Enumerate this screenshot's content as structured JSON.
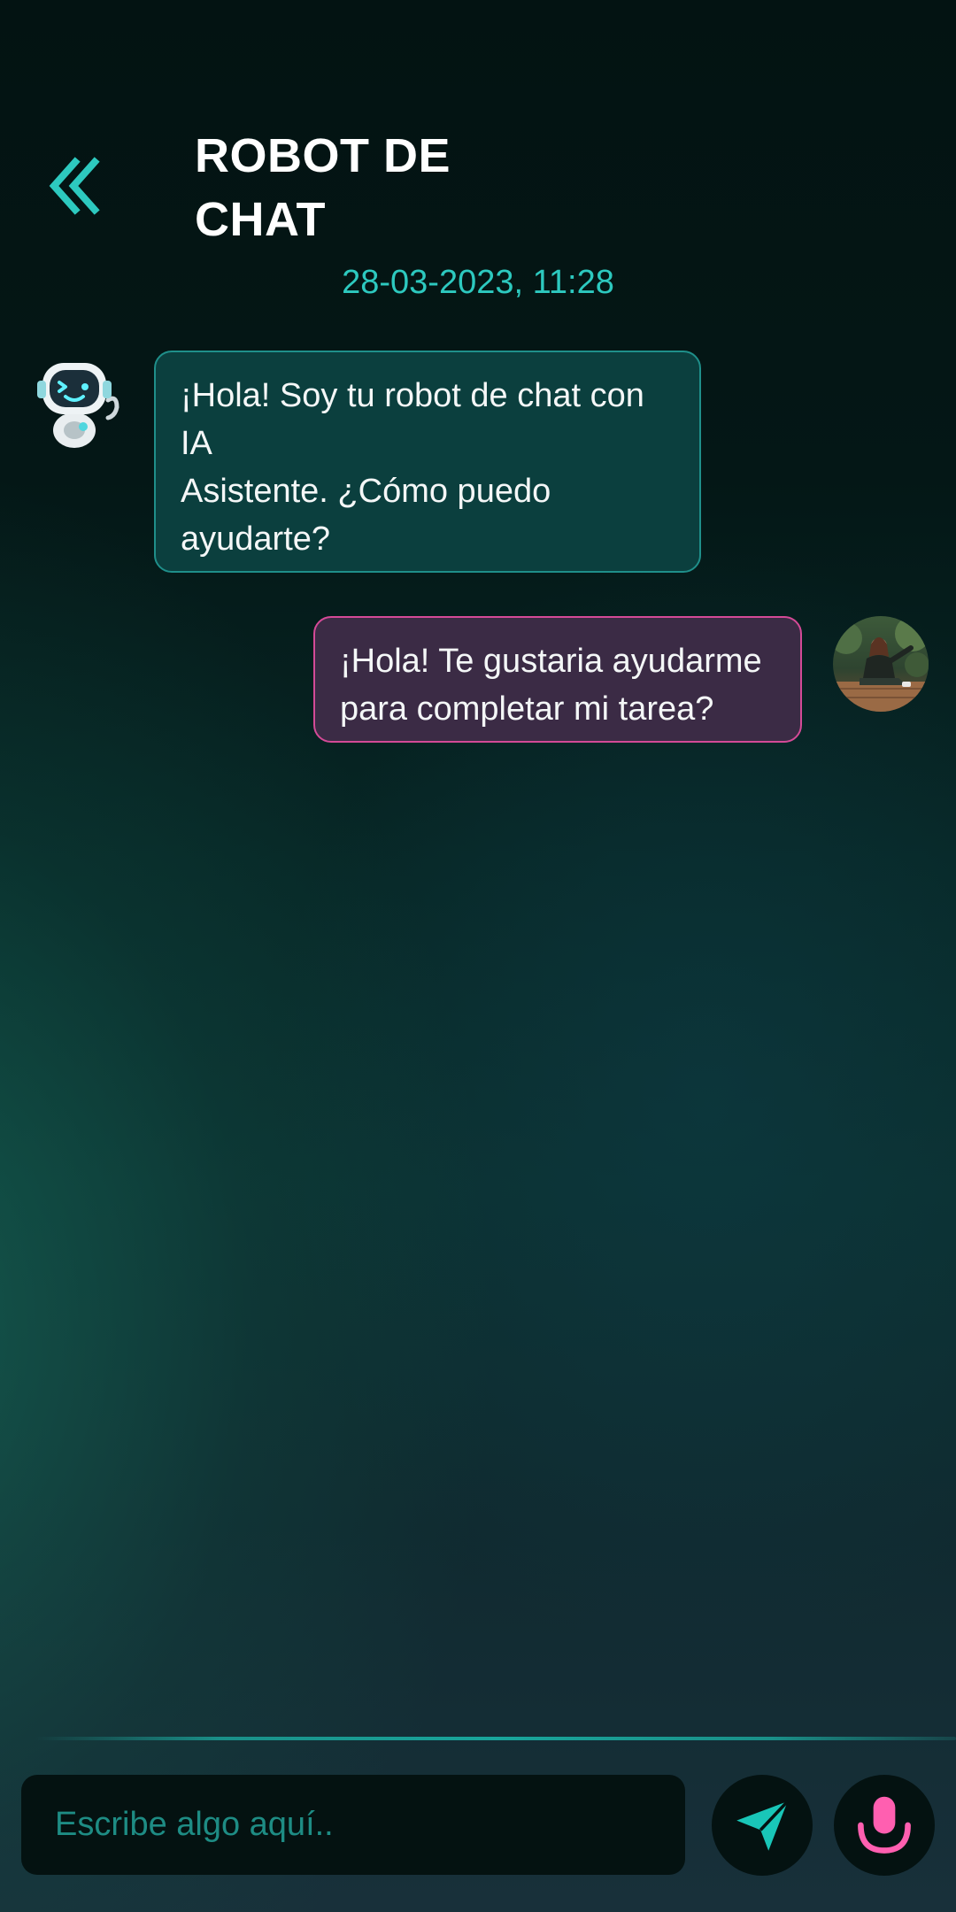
{
  "header": {
    "back_icon": "double-chevron-left-icon",
    "title_line1": "ROBOT DE",
    "title_line2": "CHAT",
    "timestamp": "28-03-2023, 11:28"
  },
  "messages": [
    {
      "sender": "bot",
      "avatar": "robot-avatar",
      "lines": [
        "¡Hola! Soy tu robot de chat con",
        "IA",
        "Asistente. ¿Cómo puedo",
        "ayudarte?"
      ]
    },
    {
      "sender": "user",
      "avatar": "user-avatar-photo",
      "lines": [
        "¡Hola! Te gustaria ayudarme",
        "para completar mi tarea?"
      ]
    }
  ],
  "composer": {
    "placeholder": "Escribe algo aquí..",
    "send_icon": "send-icon",
    "mic_icon": "microphone-icon"
  },
  "colors": {
    "accent_teal": "#2dc9bf",
    "bot_bubble_bg": "#0b3f3e",
    "bot_bubble_border": "#1f8f8a",
    "user_bubble_bg": "#3b2b45",
    "user_bubble_border": "#d44a97",
    "mic_pink": "#ff5fb0"
  }
}
